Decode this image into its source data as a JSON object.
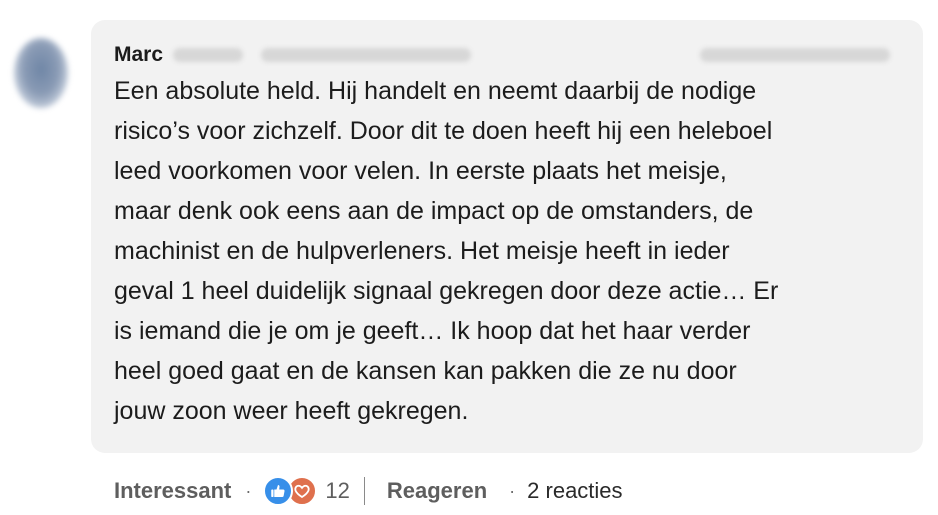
{
  "comment": {
    "author_name": "Marc",
    "text_lines": [
      "Een absolute held. Hij handelt en neemt daarbij de nodige",
      "risico’s voor zichzelf. Door dit te doen heeft hij een heleboel",
      "leed voorkomen voor velen. In eerste plaats het meisje,",
      "maar denk ook eens aan de impact op de omstanders, de",
      "machinist en de hulpverleners. Het meisje heeft in ieder",
      "geval 1 heel duidelijk signaal gekregen door deze actie… Er",
      "is iemand die je om je geeft… Ik hoop dat het haar verder",
      "heel goed gaat en de kansen kan pakken die ze nu door",
      "jouw zoon weer heeft gekregen."
    ]
  },
  "actions": {
    "reaction_label": "Interessant",
    "separator": "·",
    "reaction_icons": [
      "thumbs-up-icon",
      "heart-icon"
    ],
    "reaction_count": "12",
    "reply_label": "Reageren",
    "replies_count_label": "2 reacties"
  },
  "colors": {
    "bubble_bg": "#f2f2f2",
    "text": "#1c1c1c",
    "muted": "#5e5e5e",
    "like": "#378fe9",
    "love": "#df704d"
  }
}
